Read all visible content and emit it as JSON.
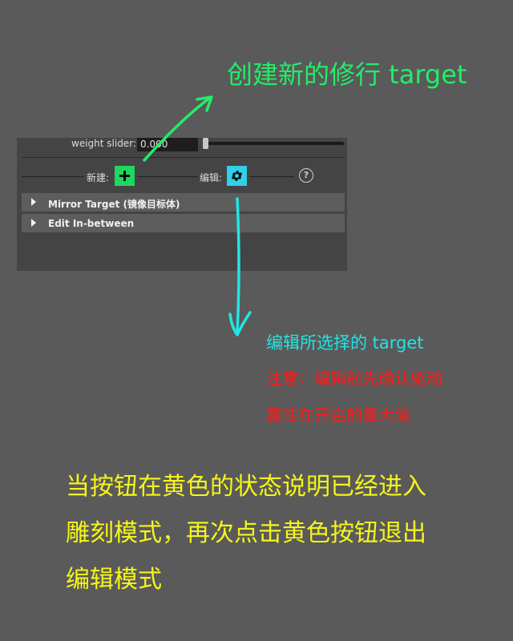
{
  "panel": {
    "weight_slider_label": "weight slider:",
    "weight_slider_value": "0.000",
    "new_label": "新建:",
    "edit_label": "编辑:",
    "help_glyph": "?",
    "sections": [
      {
        "label": "Mirror Target (镜像目标体)"
      },
      {
        "label": "Edit In-between"
      }
    ],
    "new_button_color": "#1ed760",
    "edit_button_color": "#2fd0e8"
  },
  "annotations": {
    "top_title": "创建新的修行 target",
    "edit_desc": "编辑所选择的 target",
    "note_line1": "注意：编辑前先确认驱动",
    "note_line2": "属性在开启的最大值",
    "yellow_line1": "当按钮在黄色的状态说明已经进入",
    "yellow_line2": "雕刻模式，再次点击黄色按钮退出",
    "yellow_line3": "编辑模式"
  },
  "colors": {
    "green": "#22ee66",
    "cyan": "#22e5e5",
    "red": "#ff1a1a",
    "yellow": "#f5f51a"
  }
}
